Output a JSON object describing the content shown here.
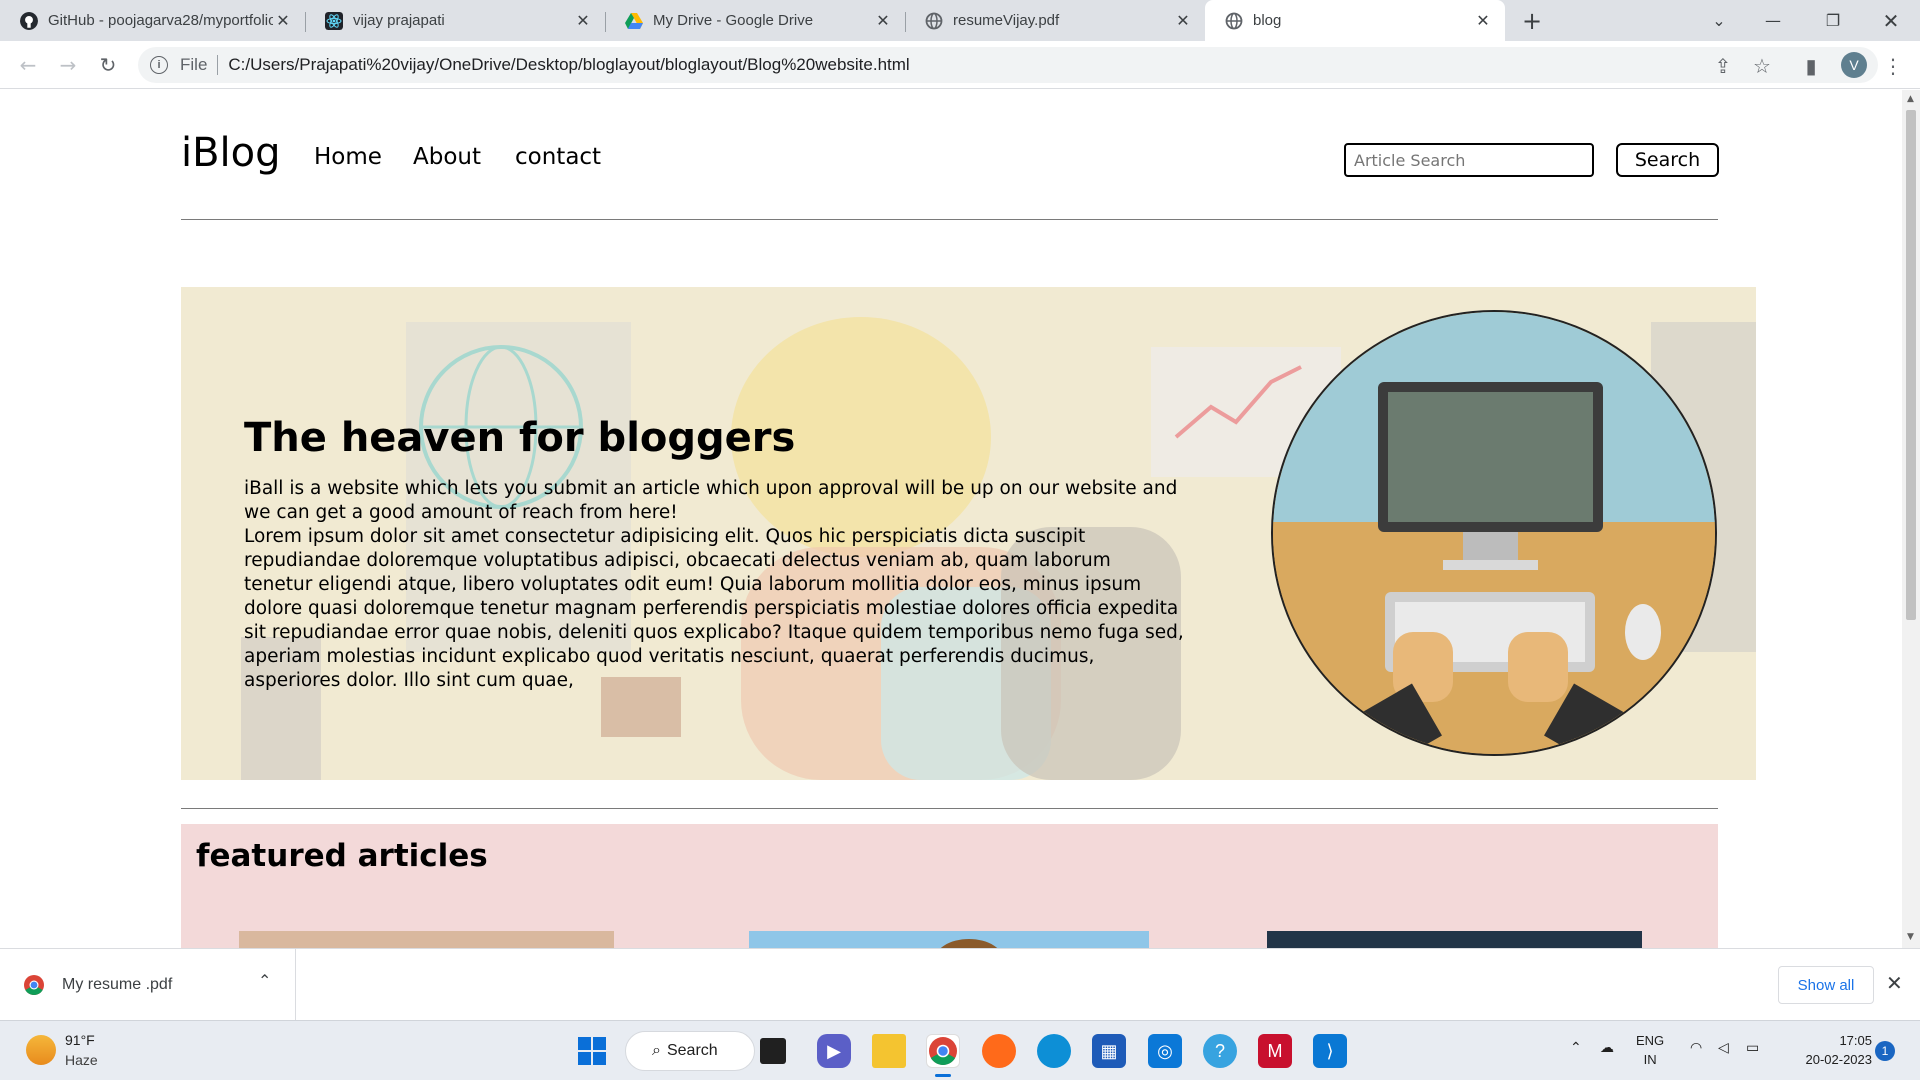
{
  "browser": {
    "tabs": [
      {
        "title": "GitHub - poojagarva28/myportfolio",
        "icon": "github-icon",
        "active": false
      },
      {
        "title": "vijay prajapati",
        "icon": "react-icon",
        "active": false
      },
      {
        "title": "My Drive - Google Drive",
        "icon": "google-drive-icon",
        "active": false
      },
      {
        "title": "resumeVijay.pdf",
        "icon": "globe-icon",
        "active": false
      },
      {
        "title": "blog",
        "icon": "globe-icon",
        "active": true
      }
    ],
    "address": {
      "scheme_label": "File",
      "url": "C:/Users/Prajapati%20vijay/OneDrive/Desktop/bloglayout/bloglayout/Blog%20website.html"
    },
    "profile_initial": "V"
  },
  "page": {
    "logo": "iBlog",
    "nav": [
      "Home",
      "About",
      "contact"
    ],
    "search": {
      "placeholder": "Article Search",
      "button": "Search"
    },
    "hero": {
      "title": "The heaven for bloggers",
      "intro": "iBall is a website which lets you submit an article which upon approval will be up on our website and we can get a good amount of reach from here!",
      "body": "Lorem ipsum dolor sit amet consectetur adipisicing elit. Quos hic perspiciatis dicta suscipit repudiandae doloremque voluptatibus adipisci, obcaecati delectus veniam ab, quam laborum tenetur eligendi atque, libero voluptates odit eum! Quia laborum mollitia dolor eos, minus ipsum dolore quasi doloremque tenetur magnam perferendis perspiciatis molestiae dolores officia expedita sit repudiandae error quae nobis, deleniti quos explicabo? Itaque quidem temporibus nemo fuga sed, aperiam molestias incidunt explicabo quod veritatis nesciunt, quaerat perferendis ducimus, asperiores dolor. Illo sint cum quae,"
    },
    "featured": {
      "title": "featured articles"
    }
  },
  "downloads": {
    "item": "My resume .pdf",
    "show_all": "Show all"
  },
  "taskbar": {
    "weather": {
      "temp": "91°F",
      "condition": "Haze"
    },
    "search_label": "Search",
    "lang": {
      "line1": "ENG",
      "line2": "IN"
    },
    "time": "17:05",
    "date": "20-02-2023",
    "notifications": "1"
  },
  "colors": {
    "hero_bg": "#f1ead2",
    "featured_bg": "#f3d9d9",
    "chrome_tabstrip": "#dee1e6",
    "link_blue": "#1a73e8"
  }
}
